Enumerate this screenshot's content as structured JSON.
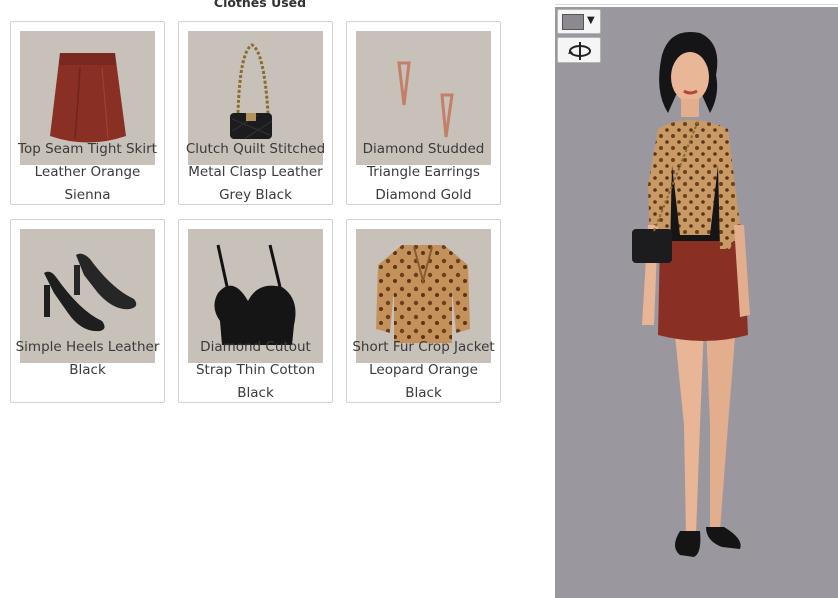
{
  "section": {
    "title": "Clothes Used"
  },
  "items": [
    {
      "label": "Top Seam Tight Skirt Leather Orange Sienna"
    },
    {
      "label": "Clutch Quilt Stitched Metal Clasp Leather Grey Black"
    },
    {
      "label": "Diamond Studded Triangle Earrings Diamond Gold"
    },
    {
      "label": "Simple Heels Leather Black"
    },
    {
      "label": "Diamond Cutout Strap Thin Cotton Black"
    },
    {
      "label": "Short Fur Crop Jacket Leopard Orange Black"
    }
  ],
  "avatar_panel": {
    "background_color": "#9a979e",
    "color_picker": {
      "icon": "color-swatch-icon",
      "dropdown_icon": "caret-down-icon"
    },
    "rotate_button": {
      "icon": "rotate-icon"
    }
  }
}
